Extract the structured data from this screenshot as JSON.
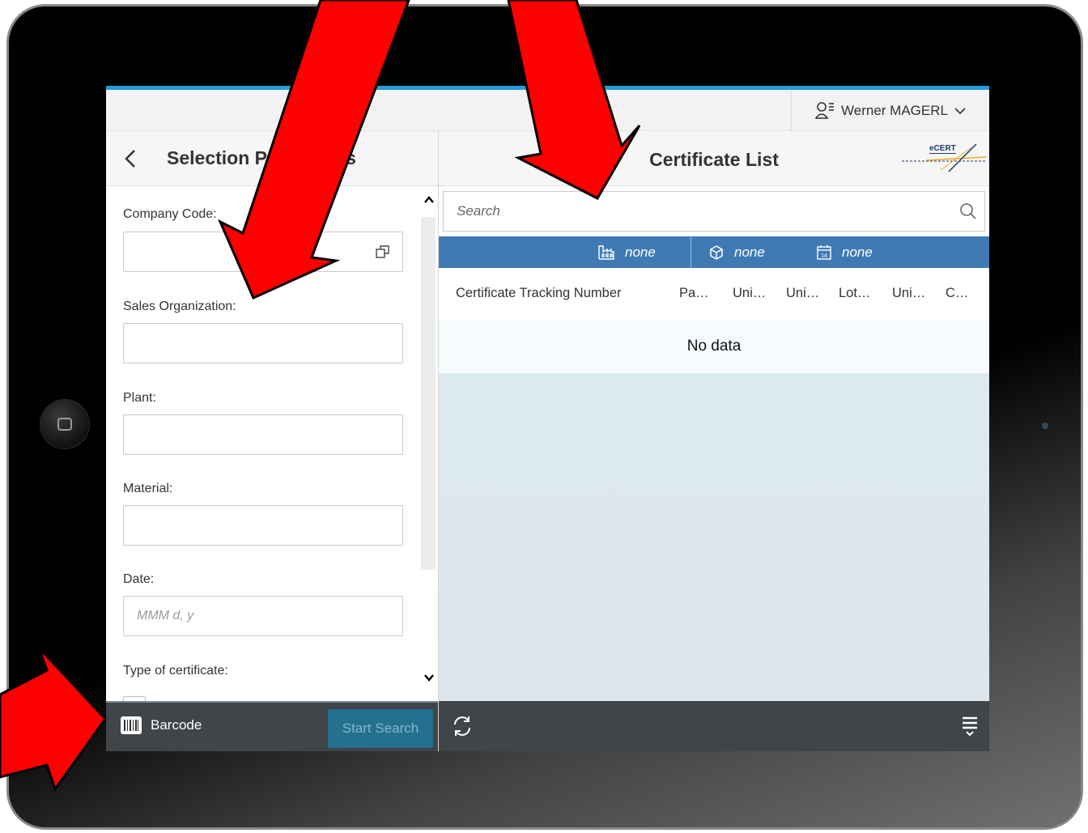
{
  "header": {
    "user_name": "Werner MAGERL"
  },
  "master": {
    "title": "Selection Parameters",
    "fields": [
      {
        "label": "Company Code:",
        "value": "",
        "placeholder": ""
      },
      {
        "label": "Sales Organization:",
        "value": "",
        "placeholder": ""
      },
      {
        "label": "Plant:",
        "value": "",
        "placeholder": ""
      },
      {
        "label": "Material:",
        "value": "",
        "placeholder": ""
      },
      {
        "label": "Date:",
        "value": "",
        "placeholder": "MMM d, y"
      }
    ],
    "type_label": "Type of certificate:",
    "footer": {
      "barcode_label": "Barcode",
      "start_search_label": "Start Search"
    }
  },
  "detail": {
    "title": "Certificate List",
    "logo_text": "eCERT",
    "search_placeholder": "Search",
    "filters": [
      {
        "icon": "plant-icon",
        "value": "none"
      },
      {
        "icon": "material-icon",
        "value": "none"
      },
      {
        "icon": "calendar-icon",
        "value": "none"
      }
    ],
    "columns": [
      "Certificate Tracking Number",
      "Pa…",
      "Uni…",
      "Uni…",
      "Lot…",
      "Uni…",
      "C…"
    ],
    "no_data_text": "No data"
  },
  "colors": {
    "accent": "#1e9fd9",
    "filter_bar": "#3f7ab4",
    "footer": "#3f4548",
    "arrow": "#ff0000"
  }
}
